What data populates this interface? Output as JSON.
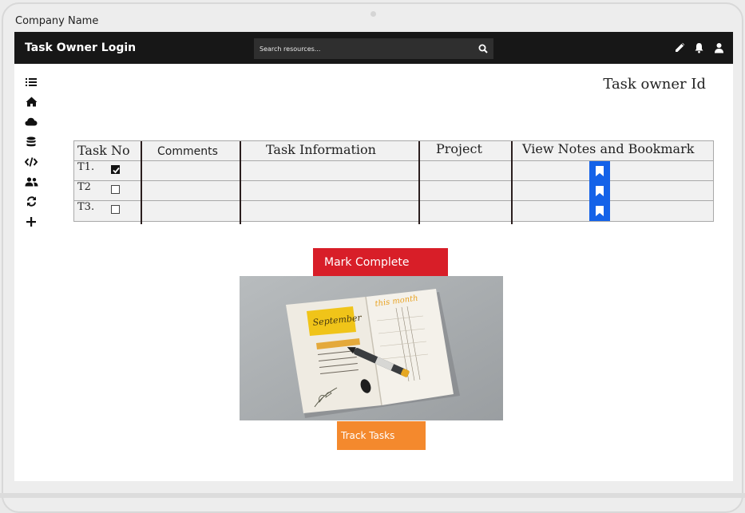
{
  "device": {
    "company_name": "Company Name"
  },
  "topbar": {
    "title": "Task Owner Login",
    "search_placeholder": "Search resources..."
  },
  "icons": {
    "search": "search-icon",
    "edit": "pencil-icon",
    "notifications": "bell-icon",
    "profile": "user-icon"
  },
  "sidebar": {
    "items": [
      {
        "icon": "list-icon"
      },
      {
        "icon": "home-icon"
      },
      {
        "icon": "cloud-icon"
      },
      {
        "icon": "database-icon"
      },
      {
        "icon": "code-icon"
      },
      {
        "icon": "users-icon"
      },
      {
        "icon": "refresh-icon"
      },
      {
        "icon": "plus-icon"
      }
    ]
  },
  "main": {
    "owner_id_label": "Task owner Id"
  },
  "table": {
    "headers": {
      "task_no": "Task No",
      "comments": "Comments",
      "task_information": "Task Information",
      "project": "Project",
      "view_notes": "View Notes and Bookmark"
    },
    "rows": [
      {
        "task": "T1.",
        "checked": true,
        "comments": "",
        "information": "",
        "project": ""
      },
      {
        "task": "T2",
        "checked": false,
        "comments": "",
        "information": "",
        "project": ""
      },
      {
        "task": "T3.",
        "checked": false,
        "comments": "",
        "information": "",
        "project": ""
      }
    ]
  },
  "actions": {
    "mark_complete": "Mark Complete",
    "track_tasks": "Track Tasks"
  },
  "image": {
    "handwritten_month": "September",
    "handwritten_header": "this month"
  },
  "colors": {
    "topbar_bg": "#171717",
    "bookmark_blue": "#1462e8",
    "mark_complete_red": "#d81e28",
    "track_tasks_orange": "#f4892d",
    "table_bg": "#f1f1f1"
  }
}
